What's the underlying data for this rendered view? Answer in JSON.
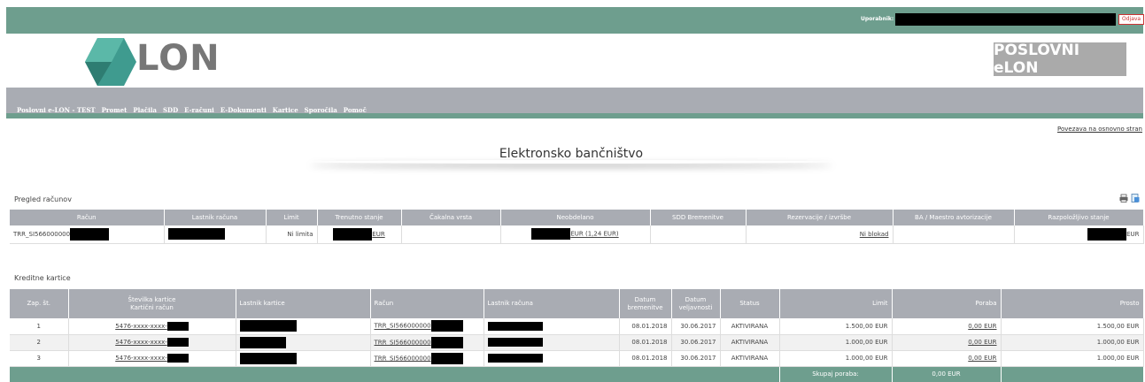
{
  "topbar": {
    "user_label": "Uporabnik:",
    "logout_label": "Odjava"
  },
  "logo": {
    "text": "LON"
  },
  "brand": {
    "label": "POSLOVNI eLON"
  },
  "nav": {
    "items": [
      "Poslovni e-LON - TEST",
      "Promet",
      "Plačila",
      "SDD",
      "E-računi",
      "E-Dokumenti",
      "Kartice",
      "Sporočila",
      "Pomoč"
    ]
  },
  "home_link": "Povezava na osnovno stran",
  "page_title": "Elektronsko bančništvo",
  "accounts": {
    "title": "Pregled računov",
    "headers": [
      "Račun",
      "Lastnik računa",
      "Limit",
      "Trenutno stanje",
      "Čakalna vrsta",
      "Neobdelano",
      "SDD Bremenitve",
      "Rezervacije / izvršbe",
      "BA / Maestro avtorizacije",
      "Razpoložljivo stanje"
    ],
    "row": {
      "account": "TRR_SI566000000",
      "limit": "Ni limita",
      "current_currency": "EUR",
      "unprocessed": "EUR (1,24 EUR)",
      "reservations": "Ni blokad",
      "available_currency": "EUR"
    }
  },
  "cards": {
    "title": "Kreditne kartice",
    "headers": {
      "no": "Zap. št.",
      "card_line1": "Številka kartice",
      "card_line2": "Kartični račun",
      "card_owner": "Lastnik kartice",
      "account": "Račun",
      "account_owner": "Lastnik računa",
      "charge_line1": "Datum",
      "charge_line2": "bremenitve",
      "valid_line1": "Datum",
      "valid_line2": "veljavnosti",
      "status": "Status",
      "limit": "Limit",
      "usage": "Poraba",
      "free": "Prosto"
    },
    "rows": [
      {
        "no": "1",
        "card": "5476-xxxx-xxxx-",
        "account": "TRR_SI566000000",
        "charge_date": "08.01.2018",
        "valid_date": "30.06.2017",
        "status": "AKTIVIRANA",
        "limit": "1.500,00 EUR",
        "usage": "0,00 EUR",
        "free": "1.500,00 EUR"
      },
      {
        "no": "2",
        "card": "5476-xxxx-xxxx-",
        "account": "TRR_SI566000000",
        "charge_date": "08.01.2018",
        "valid_date": "30.06.2017",
        "status": "AKTIVIRANA",
        "limit": "1.000,00 EUR",
        "usage": "0,00 EUR",
        "free": "1.000,00 EUR"
      },
      {
        "no": "3",
        "card": "5476-xxxx-xxxx-",
        "account": "TRR_SI566000000",
        "charge_date": "08.01.2018",
        "valid_date": "30.06.2017",
        "status": "AKTIVIRANA",
        "limit": "1.000,00 EUR",
        "usage": "0,00 EUR",
        "free": "1.000,00 EUR"
      }
    ],
    "footer": {
      "label": "Skupaj poraba:",
      "value": "0,00 EUR"
    }
  },
  "colors": {
    "accent": "#6e9e8e",
    "nav_bg": "#a9acb3",
    "logo_teal": "#3f9b8f"
  }
}
